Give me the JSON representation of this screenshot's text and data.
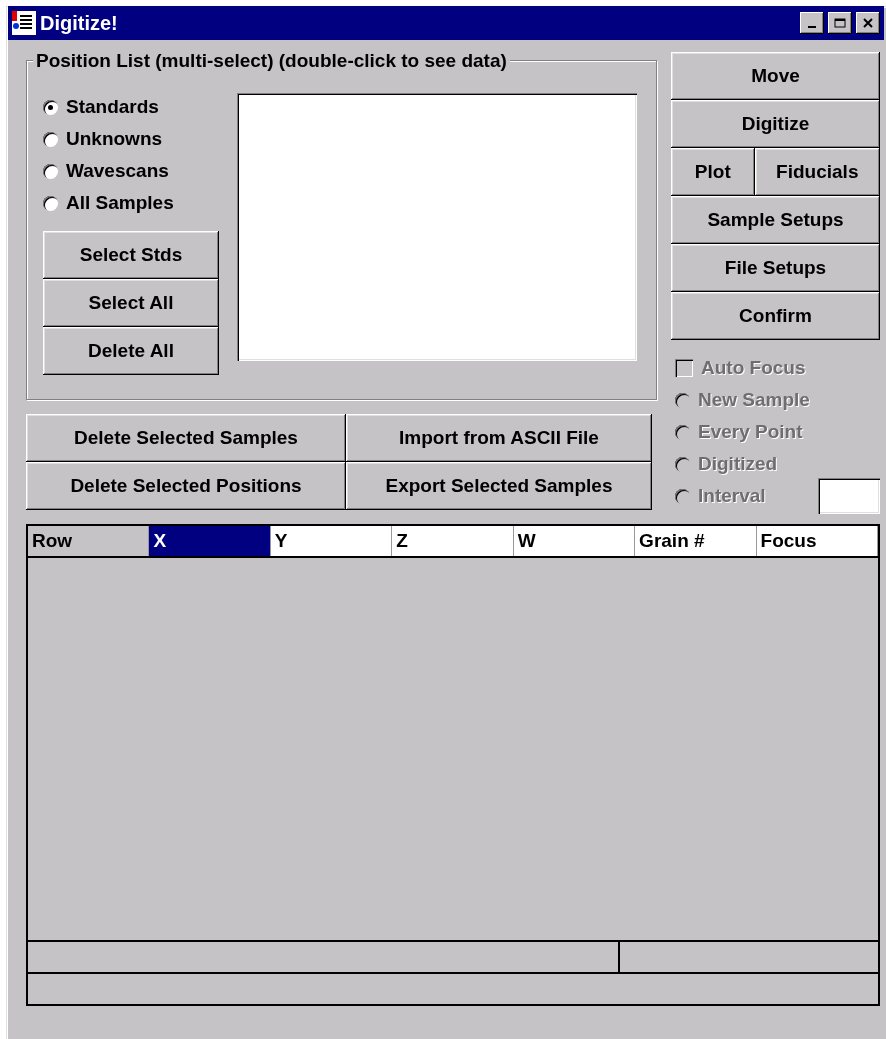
{
  "window": {
    "title": "Digitize!"
  },
  "position_list": {
    "legend": "Position List (multi-select) (double-click to see data)",
    "filters": [
      {
        "label": "Standards",
        "selected": true
      },
      {
        "label": "Unknowns",
        "selected": false
      },
      {
        "label": "Wavescans",
        "selected": false
      },
      {
        "label": "All Samples",
        "selected": false
      }
    ],
    "buttons": [
      "Select Stds",
      "Select All",
      "Delete All"
    ]
  },
  "sample_buttons": [
    [
      "Delete Selected Samples",
      "Import from ASCII File"
    ],
    [
      "Delete Selected Positions",
      "Export Selected Samples"
    ]
  ],
  "action_buttons": [
    [
      "Move"
    ],
    [
      "Digitize"
    ],
    [
      "Plot",
      "Fiducials"
    ],
    [
      "Sample Setups"
    ],
    [
      "File Setups"
    ],
    [
      "Confirm"
    ]
  ],
  "auto_focus": {
    "label": "Auto Focus",
    "checked": false,
    "disabled": true
  },
  "focus_modes": [
    {
      "label": "New Sample",
      "selected": false,
      "disabled": true
    },
    {
      "label": "Every Point",
      "selected": false,
      "disabled": true
    },
    {
      "label": "Digitized",
      "selected": false,
      "disabled": true
    },
    {
      "label": "Interval",
      "selected": false,
      "disabled": true
    }
  ],
  "table": {
    "columns": [
      {
        "label": "Row",
        "selected": false
      },
      {
        "label": "X",
        "selected": true
      },
      {
        "label": "Y",
        "selected": false
      },
      {
        "label": "Z",
        "selected": false
      },
      {
        "label": "W",
        "selected": false
      },
      {
        "label": "Grain #",
        "selected": false
      },
      {
        "label": "Focus",
        "selected": false
      }
    ]
  }
}
